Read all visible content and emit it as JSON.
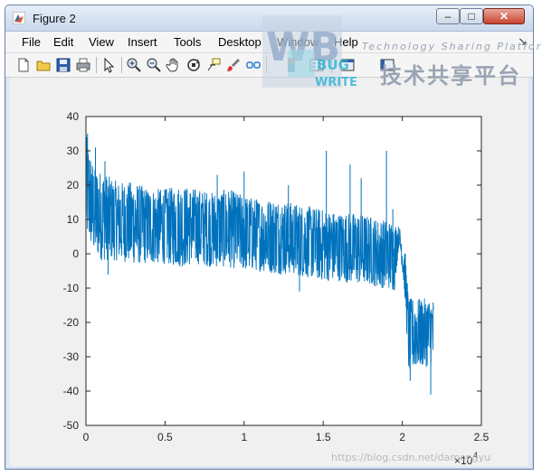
{
  "window": {
    "title": "Figure 2",
    "buttons": {
      "minimize": "–",
      "maximize": "□",
      "close": "✕"
    }
  },
  "menu": {
    "items": [
      "File",
      "Edit",
      "View",
      "Insert",
      "Tools",
      "Desktop",
      "Window",
      "Help"
    ],
    "overflow": "↘"
  },
  "toolbar": {
    "icons": [
      "new-figure-icon",
      "open-file-icon",
      "save-icon",
      "print-icon",
      "arrow-pointer-icon",
      "zoom-in-icon",
      "zoom-out-icon",
      "pan-hand-icon",
      "rotate-3d-icon",
      "data-cursor-icon",
      "brush-icon",
      "link-plot-icon",
      "insert-colorbar-icon",
      "insert-legend-icon",
      "hide-plot-tools-icon",
      "show-plot-tools-icon"
    ]
  },
  "watermark": {
    "logo_letters": "WB",
    "bug": "BUG",
    "write": "WRITE",
    "tagline": "Technology Sharing Platform",
    "chinese": "技术共享平台",
    "url": "https://blog.csdn.net/damongyu"
  },
  "colors": {
    "series": "#0072bd",
    "axes_bg": "#ffffff",
    "figure_bg": "#f0f0f0"
  },
  "chart_data": {
    "type": "line",
    "title": "",
    "xlabel": "",
    "ylabel": "",
    "xlim": [
      0,
      2.5
    ],
    "ylim": [
      -50,
      40
    ],
    "x_exponent_label": "×10",
    "x_exponent_power": "4",
    "x_ticks": [
      "0",
      "0.5",
      "1",
      "1.5",
      "2",
      "2.5"
    ],
    "y_ticks": [
      "40",
      "30",
      "20",
      "10",
      "0",
      "-10",
      "-20",
      "-30",
      "-40",
      "-50"
    ],
    "grid": false,
    "series": [
      {
        "envelope_x": [
          0,
          0.05,
          0.1,
          0.2,
          0.3,
          0.4,
          0.5,
          0.6,
          0.7,
          0.8,
          0.9,
          1.0,
          1.1,
          1.2,
          1.3,
          1.4,
          1.5,
          1.6,
          1.7,
          1.8,
          1.85,
          1.9,
          1.95,
          1.98,
          2.0,
          2.02,
          2.04,
          2.06,
          2.1,
          2.15,
          2.2
        ],
        "upper": [
          35,
          25,
          24,
          21,
          21,
          19,
          19,
          20,
          19,
          18,
          19,
          17,
          16,
          16,
          15,
          14,
          13,
          12,
          12,
          11,
          10,
          10,
          9,
          8,
          5,
          0,
          -13,
          -13,
          -13,
          -13,
          -13
        ],
        "lower": [
          5,
          0,
          -2,
          -2,
          -3,
          -3,
          -3,
          -4,
          -3,
          -4,
          -4,
          -5,
          -5,
          -6,
          -6,
          -7,
          -8,
          -8,
          -9,
          -9,
          -10,
          -10,
          -11,
          3,
          -5,
          -15,
          -35,
          -34,
          -33,
          -33,
          -33
        ],
        "spikes": [
          {
            "x": 0.01,
            "y": 35
          },
          {
            "x": 0.06,
            "y": 31
          },
          {
            "x": 0.12,
            "y": 27
          },
          {
            "x": 0.83,
            "y": 23
          },
          {
            "x": 1.0,
            "y": 24
          },
          {
            "x": 1.28,
            "y": 20
          },
          {
            "x": 1.52,
            "y": 30
          },
          {
            "x": 1.67,
            "y": 26
          },
          {
            "x": 1.74,
            "y": 22
          },
          {
            "x": 1.9,
            "y": 30
          },
          {
            "x": 1.94,
            "y": 13
          },
          {
            "x": 2.05,
            "y": -37
          },
          {
            "x": 2.18,
            "y": -41
          },
          {
            "x": 1.35,
            "y": -11
          },
          {
            "x": 0.14,
            "y": -6
          }
        ]
      }
    ]
  }
}
